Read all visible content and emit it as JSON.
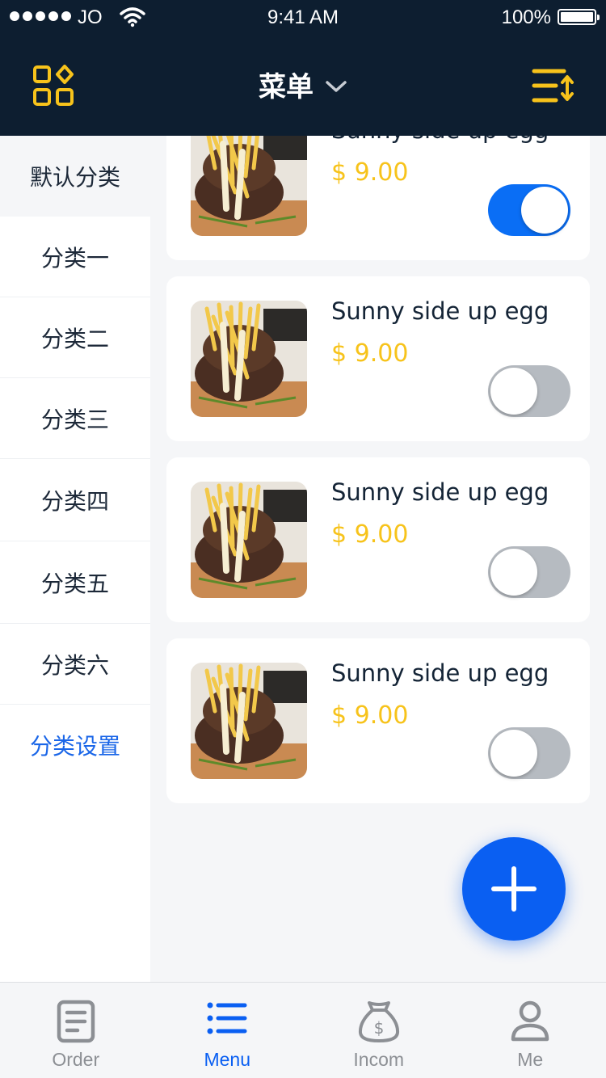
{
  "status_bar": {
    "carrier": "JO",
    "time": "9:41 AM",
    "battery": "100%"
  },
  "nav": {
    "title": "菜单",
    "left_icon": "grid-icon",
    "title_icon": "chevron-down-icon",
    "right_icon": "sort-icon"
  },
  "sidebar": {
    "items": [
      {
        "label": "默认分类",
        "active": true
      },
      {
        "label": "分类一"
      },
      {
        "label": "分类二"
      },
      {
        "label": "分类三"
      },
      {
        "label": "分类四"
      },
      {
        "label": "分类五"
      },
      {
        "label": "分类六"
      }
    ],
    "settings_label": "分类设置"
  },
  "menu_items": [
    {
      "name": "Sunny side up egg",
      "price": "$ 9.00",
      "enabled": true
    },
    {
      "name": "Sunny side up egg",
      "price": "$ 9.00",
      "enabled": false
    },
    {
      "name": "Sunny side up egg",
      "price": "$ 9.00",
      "enabled": false
    },
    {
      "name": "Sunny side up egg",
      "price": "$ 9.00",
      "enabled": false
    }
  ],
  "fab": {
    "icon": "plus-icon"
  },
  "tabbar": {
    "tabs": [
      {
        "label": "Order",
        "icon": "order-icon"
      },
      {
        "label": "Menu",
        "icon": "menu-list-icon",
        "active": true
      },
      {
        "label": "Incom",
        "icon": "money-bag-icon"
      },
      {
        "label": "Me",
        "icon": "user-icon"
      }
    ]
  },
  "colors": {
    "header_bg": "#0d1e30",
    "accent_blue": "#0a5ff2",
    "price_yellow": "#f7c31b",
    "icon_yellow": "#f7c31b"
  }
}
